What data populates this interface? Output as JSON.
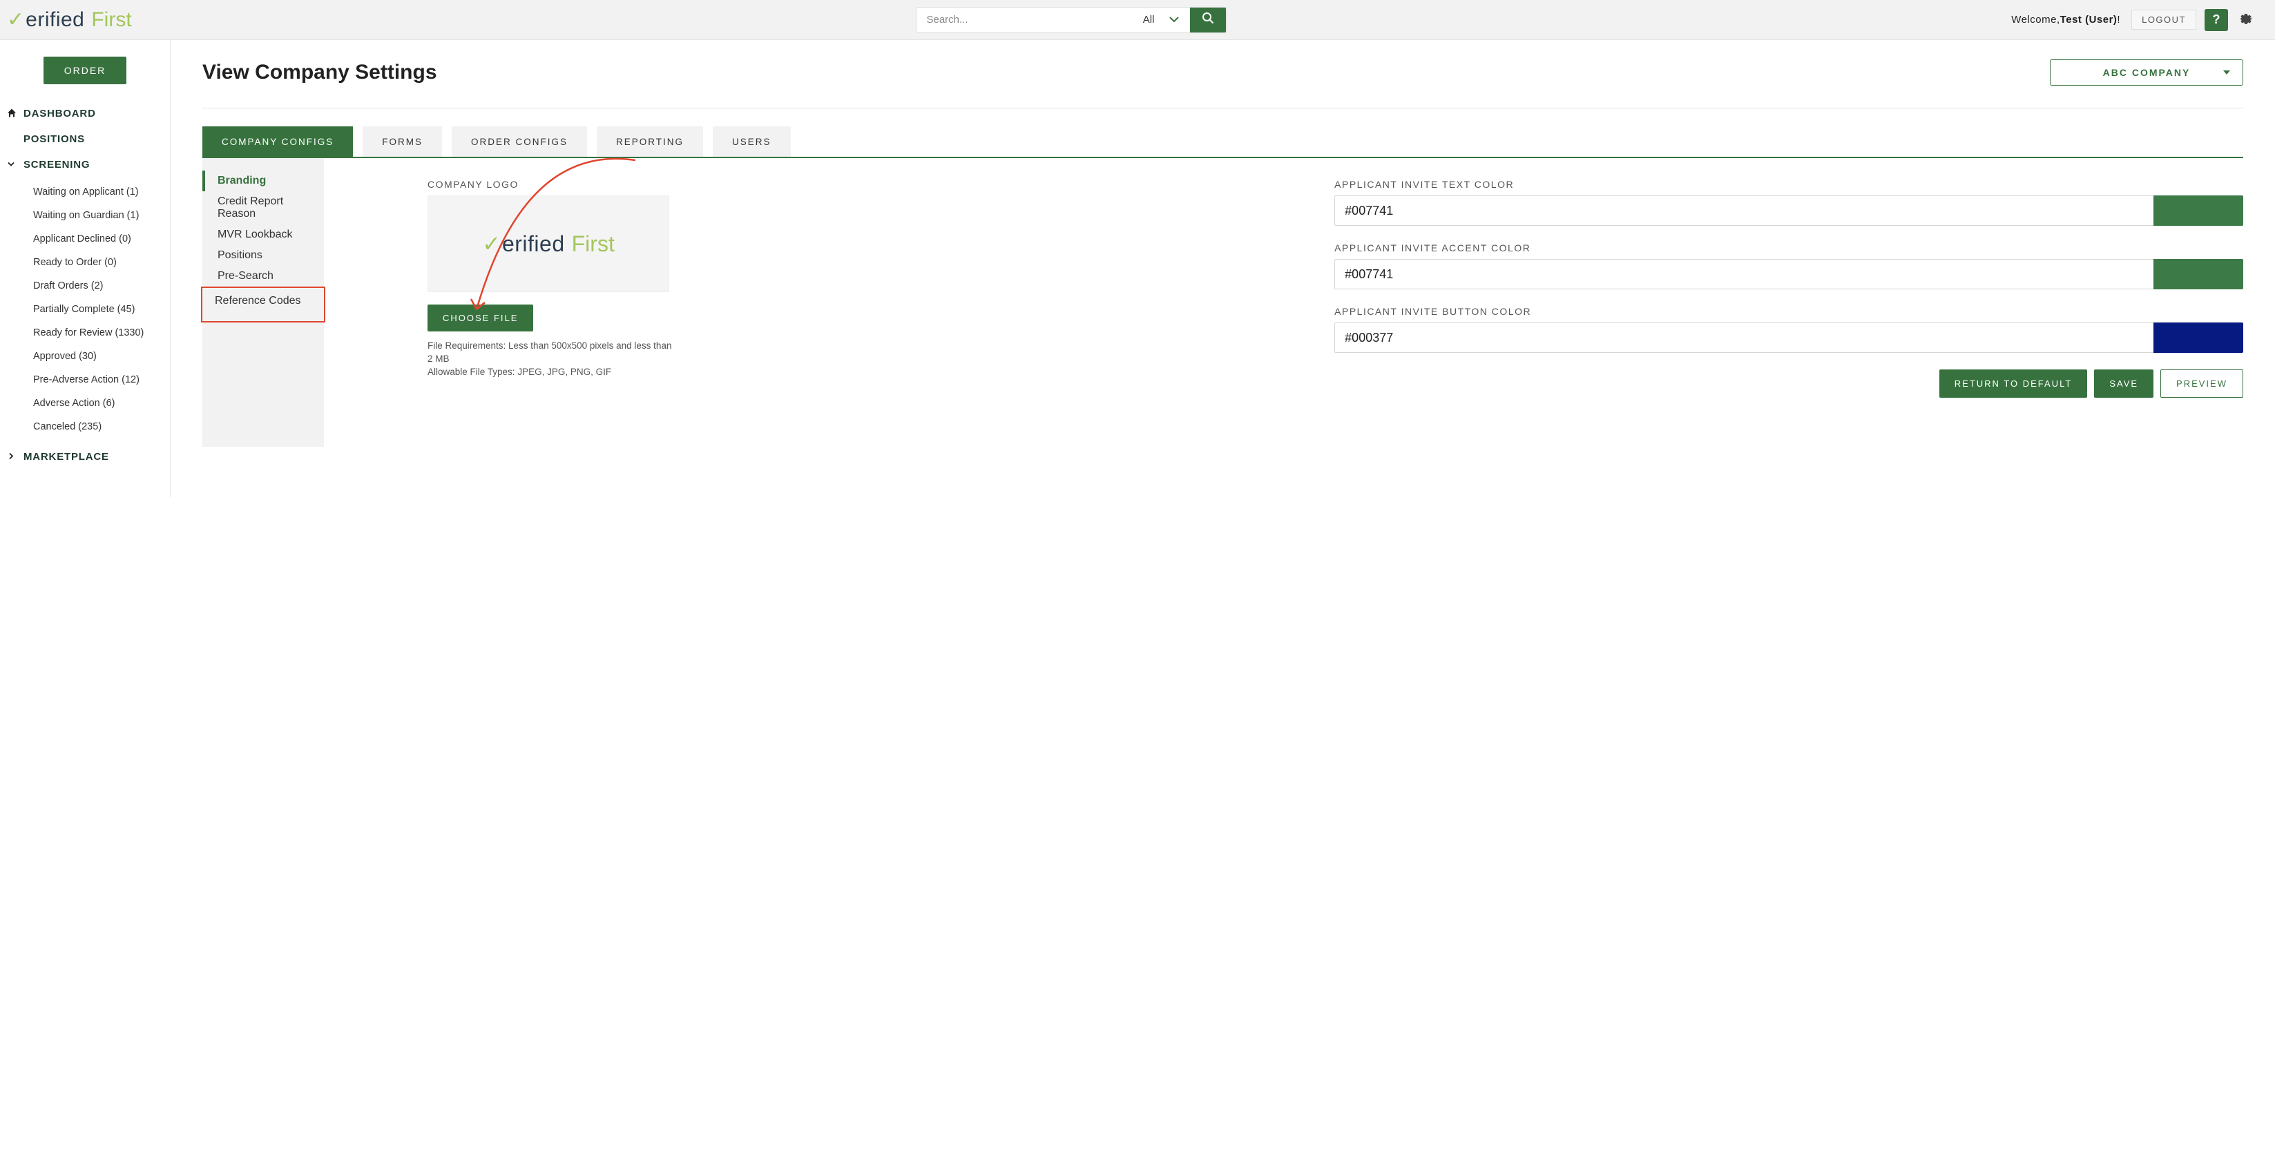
{
  "brand": {
    "verified": "erified",
    "first": "First"
  },
  "search": {
    "placeholder": "Search...",
    "category": "All"
  },
  "welcome": {
    "prefix": "Welcome,",
    "user": "Test (User)",
    "suffix": "!"
  },
  "buttons": {
    "logout": "LOGOUT",
    "help": "?",
    "order": "ORDER",
    "choose_file": "CHOOSE FILE",
    "return_default": "RETURN TO DEFAULT",
    "save": "SAVE",
    "preview": "PREVIEW"
  },
  "sidebar": {
    "dashboard": "DASHBOARD",
    "positions": "POSITIONS",
    "screening": "SCREENING",
    "marketplace": "MARKETPLACE",
    "screening_items": [
      "Waiting on Applicant (1)",
      "Waiting on Guardian (1)",
      "Applicant Declined (0)",
      "Ready to Order (0)",
      "Draft Orders (2)",
      "Partially Complete (45)",
      "Ready for Review (1330)",
      "Approved (30)",
      "Pre-Adverse Action (12)",
      "Adverse Action (6)",
      "Canceled (235)"
    ]
  },
  "page": {
    "title": "View Company Settings",
    "company": "ABC COMPANY"
  },
  "tabs": {
    "company_configs": "COMPANY CONFIGS",
    "forms": "FORMS",
    "order_configs": "ORDER CONFIGS",
    "reporting": "REPORTING",
    "users": "USERS"
  },
  "subtabs": {
    "branding": "Branding",
    "credit_report_reason": "Credit Report Reason",
    "mvr_lookback": "MVR Lookback",
    "positions": "Positions",
    "pre_search": "Pre-Search",
    "reference_codes": "Reference Codes"
  },
  "panel": {
    "company_logo_label": "COMPANY LOGO",
    "file_req_1": "File Requirements: Less than 500x500 pixels and less than 2 MB",
    "file_req_2": "Allowable File Types: JPEG, JPG, PNG, GIF",
    "text_color_label": "APPLICANT INVITE TEXT COLOR",
    "accent_color_label": "APPLICANT INVITE ACCENT COLOR",
    "button_color_label": "APPLICANT INVITE BUTTON COLOR",
    "text_color_value": "#007741",
    "accent_color_value": "#007741",
    "button_color_value": "#000377"
  }
}
